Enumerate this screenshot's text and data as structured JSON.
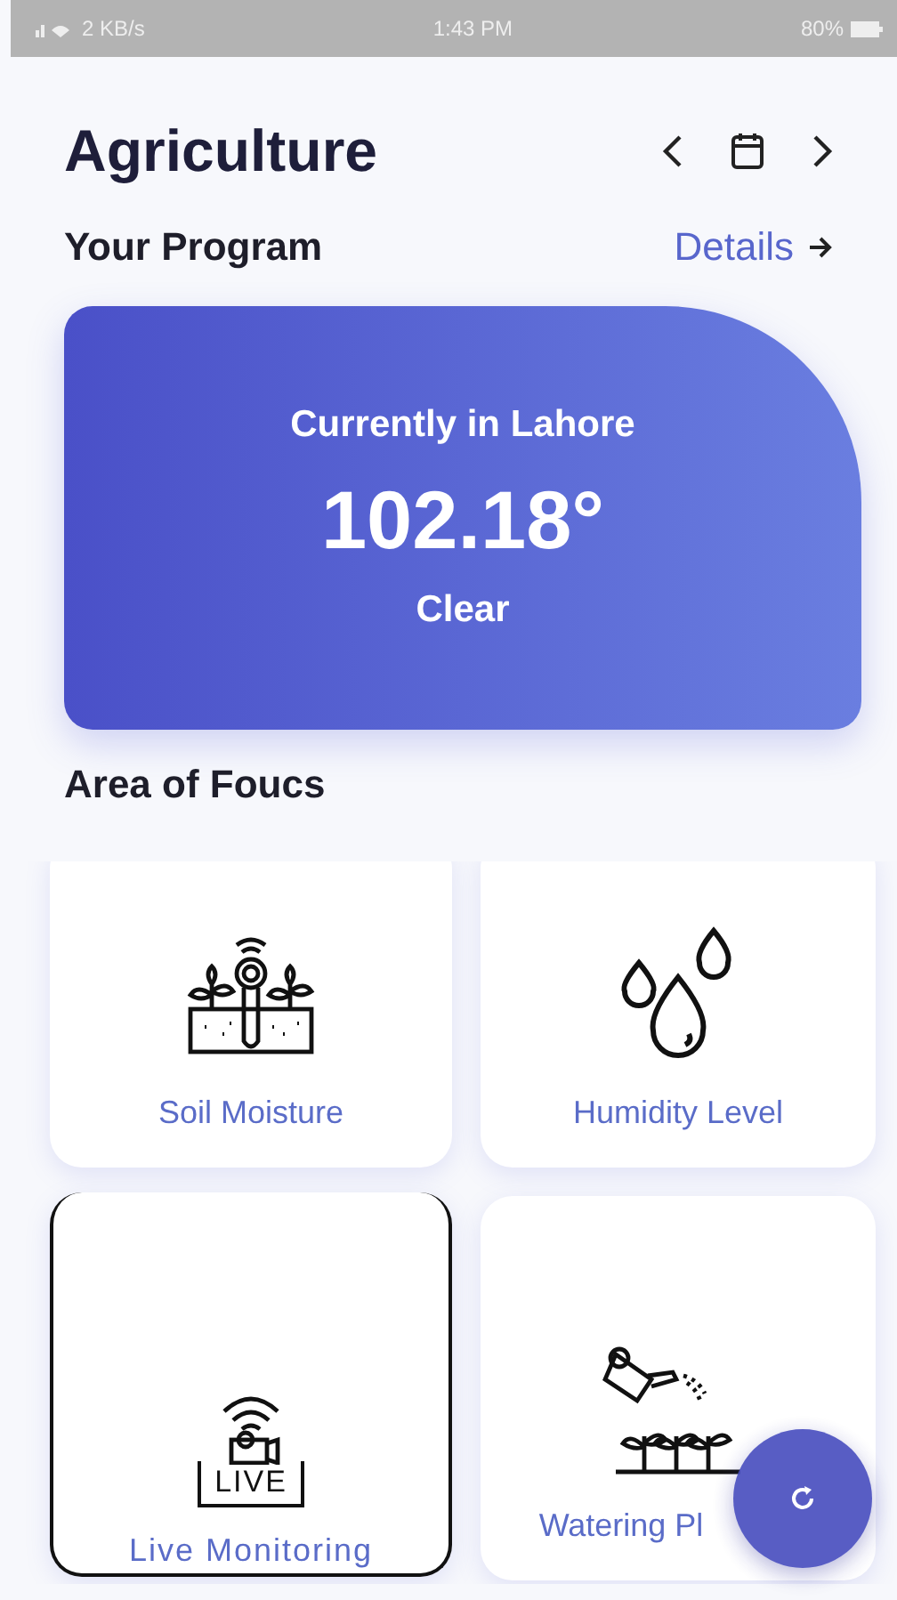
{
  "status_bar": {
    "network": "2 KB/s",
    "time": "1:43 PM",
    "battery": "80%"
  },
  "header": {
    "title": "Agriculture"
  },
  "program": {
    "title": "Your Program",
    "link": "Details"
  },
  "weather": {
    "location": "Currently in Lahore",
    "temperature": "102.18°",
    "condition": "Clear"
  },
  "focus": {
    "title": "Area of Foucs",
    "items": [
      {
        "kind": "soil",
        "label": "Soil Moisture"
      },
      {
        "kind": "humidity",
        "label": "Humidity Level"
      },
      {
        "kind": "live",
        "label": "Live Monitoring",
        "badge": "LIVE"
      },
      {
        "kind": "watering",
        "label": "Watering Pl"
      }
    ]
  }
}
